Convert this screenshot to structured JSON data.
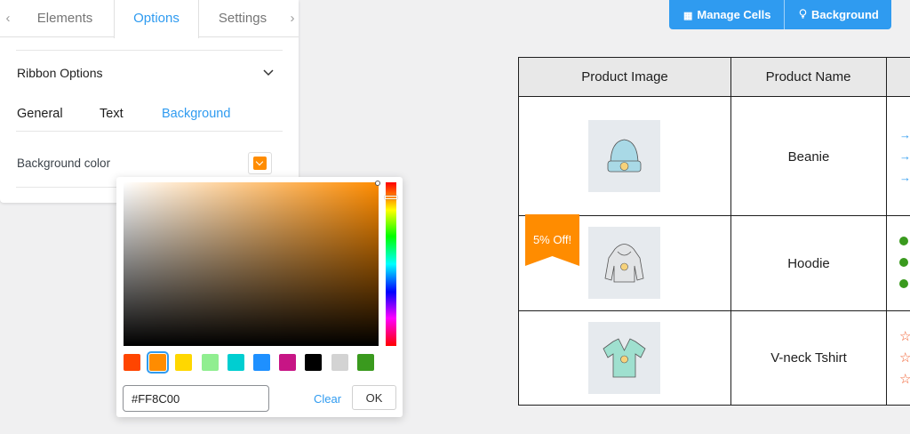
{
  "panel": {
    "tabs": [
      "Elements",
      "Options",
      "Settings"
    ],
    "active_tab": "Options",
    "section_title": "Ribbon Options",
    "subtabs": [
      "General",
      "Text",
      "Background"
    ],
    "active_subtab": "Background",
    "bg_color_label": "Background color",
    "bg_color_value": "#FF8C00"
  },
  "picker": {
    "hex_value": "#FF8C00",
    "clear_label": "Clear",
    "ok_label": "OK",
    "presets": [
      "#ff4500",
      "#ff8c00",
      "#ffd700",
      "#90ee90",
      "#00ced1",
      "#1e90ff",
      "#c71585",
      "#000000",
      "#d3d3d3",
      "#3a9a1e"
    ],
    "selected_preset": "#ff8c00"
  },
  "toolbar": {
    "manage_cells_label": "Manage Cells",
    "background_label": "Background"
  },
  "table": {
    "headers": [
      "Product Image",
      "Product Name"
    ],
    "rows": [
      {
        "name": "Beanie",
        "marker": "arrow"
      },
      {
        "name": "Hoodie",
        "marker": "dot",
        "ribbon": "5% Off!"
      },
      {
        "name": "V-neck Tshirt",
        "marker": "star"
      }
    ]
  },
  "colors": {
    "accent": "#2f9bf0",
    "ribbon": "#ff8c00"
  }
}
